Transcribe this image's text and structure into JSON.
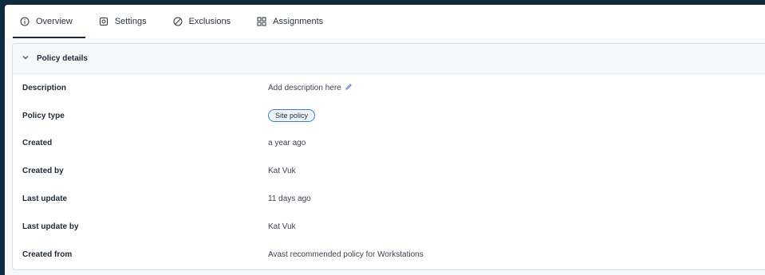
{
  "tabs": [
    {
      "label": "Overview",
      "icon": "info-icon",
      "active": true
    },
    {
      "label": "Settings",
      "icon": "settings-icon",
      "active": false
    },
    {
      "label": "Exclusions",
      "icon": "exclusion-icon",
      "active": false
    },
    {
      "label": "Assignments",
      "icon": "assignments-icon",
      "active": false
    }
  ],
  "section": {
    "title": "Policy details",
    "expanded": true
  },
  "details": [
    {
      "label": "Description",
      "value": "Add description here",
      "editable": true
    },
    {
      "label": "Policy type",
      "value": "Site policy",
      "badge": true
    },
    {
      "label": "Created",
      "value": "a year ago"
    },
    {
      "label": "Created by",
      "value": "Kat Vuk"
    },
    {
      "label": "Last update",
      "value": "11 days ago"
    },
    {
      "label": "Last update by",
      "value": "Kat Vuk"
    },
    {
      "label": "Created from",
      "value": "Avast recommended policy for Workstations"
    }
  ],
  "colors": {
    "accent": "#3b7dd8",
    "background": "#0f2a3d"
  }
}
